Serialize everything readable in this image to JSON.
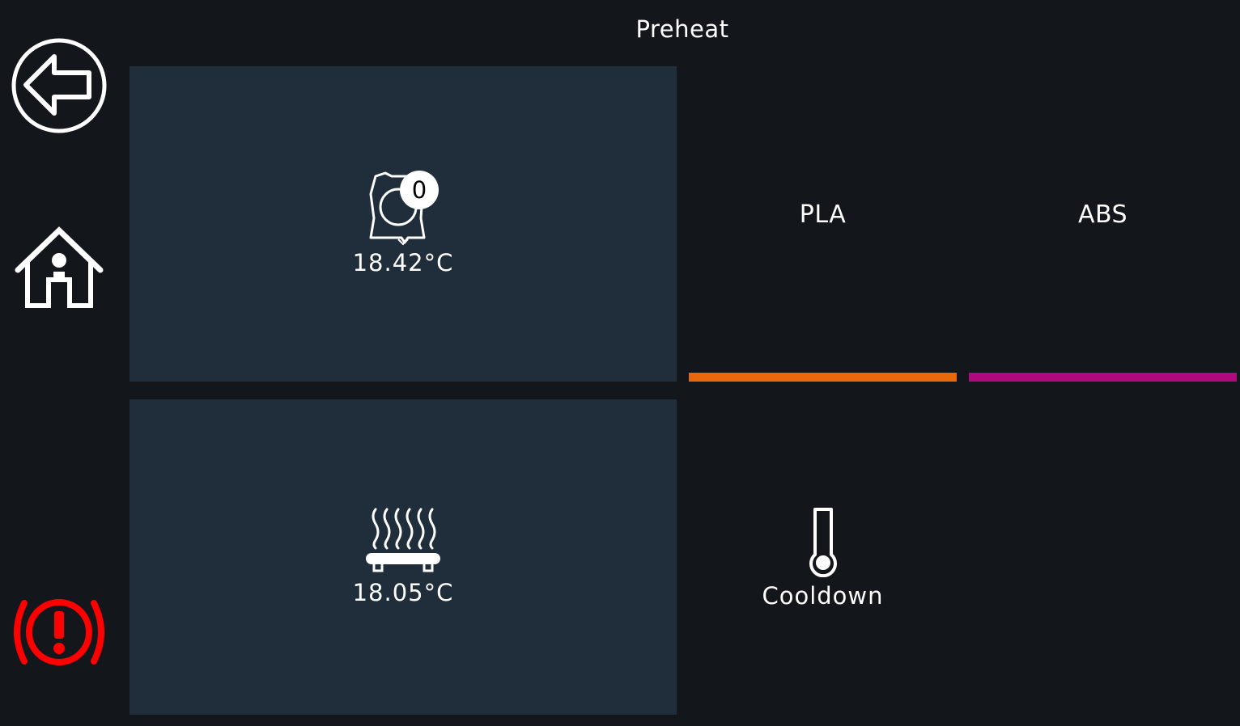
{
  "header": {
    "title": "Preheat"
  },
  "nav": {
    "back_icon": "back-arrow-icon",
    "home_icon": "home-icon",
    "emergency_icon": "emergency-stop-icon"
  },
  "heaters": {
    "extruder": {
      "icon": "extruder-icon",
      "index": "0",
      "temperature": "18.42°C"
    },
    "bed": {
      "icon": "heated-bed-icon",
      "temperature": "18.05°C"
    }
  },
  "presets": [
    {
      "label": "PLA",
      "color": "#e8690b"
    },
    {
      "label": "ABS",
      "color": "#b0097d"
    }
  ],
  "cooldown": {
    "icon": "thermometer-icon",
    "label": "Cooldown"
  },
  "colors": {
    "background": "#13171b",
    "tile": "#202e3b",
    "emergency": "#ff0000"
  }
}
